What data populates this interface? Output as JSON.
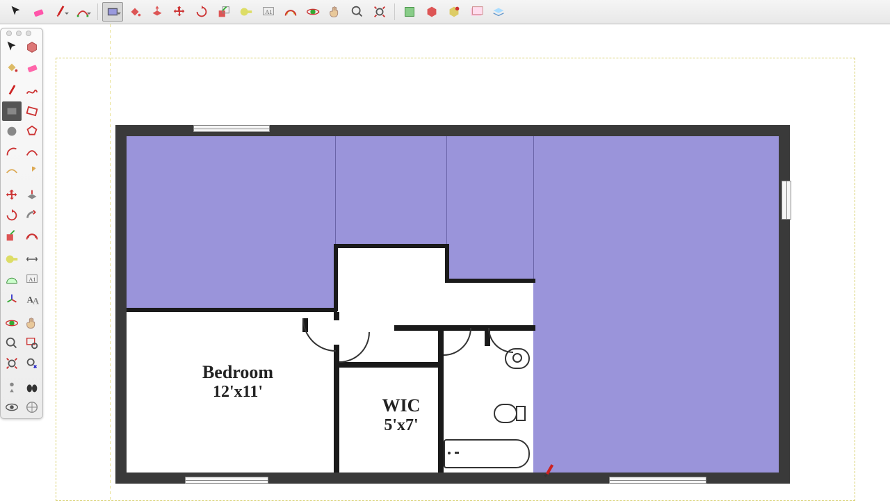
{
  "rooms": {
    "bedroom": {
      "name": "Bedroom",
      "dim": "12'x11'"
    },
    "wic": {
      "name": "WIC",
      "dim": "5'x7'"
    }
  },
  "colors": {
    "fill": "#9A94DA",
    "wall": "#3a3a3a"
  },
  "top_tools": [
    "select-icon",
    "eraser-icon",
    "pencil-icon",
    "line-icon",
    "rectangle-icon",
    "paint-bucket-icon",
    "curve-icon",
    "move-icon",
    "rotate-icon",
    "scale-icon",
    "tape-icon",
    "text-icon",
    "push-pull-icon",
    "follow-me-icon",
    "pan-icon",
    "zoom-icon",
    "zoom-extents-icon",
    "previous-icon",
    "model-icon",
    "component-icon",
    "image-icon",
    "layers-icon"
  ],
  "left_tools": [
    "select-icon",
    "make-component-icon",
    "paint-icon",
    "eraser-icon",
    "pencil-icon",
    "freehand-icon",
    "rectangle-icon",
    "rotated-rect-icon",
    "circle-icon",
    "polygon-icon",
    "arc-icon",
    "pie-icon",
    "arc2-icon",
    "arc3-icon",
    "move-icon",
    "push-pull-icon",
    "rotate-icon",
    "follow-icon",
    "scale-icon",
    "offset-icon",
    "tape-icon",
    "dimension-icon",
    "protractor-icon",
    "text-icon",
    "axes-icon",
    "3dtext-icon",
    "orbit-icon",
    "pan-icon",
    "zoom-icon",
    "zoom-window-icon",
    "zoom-extents-icon",
    "previous-view-icon",
    "position-camera-icon",
    "walk-icon",
    "look-around-icon",
    "section-icon"
  ]
}
